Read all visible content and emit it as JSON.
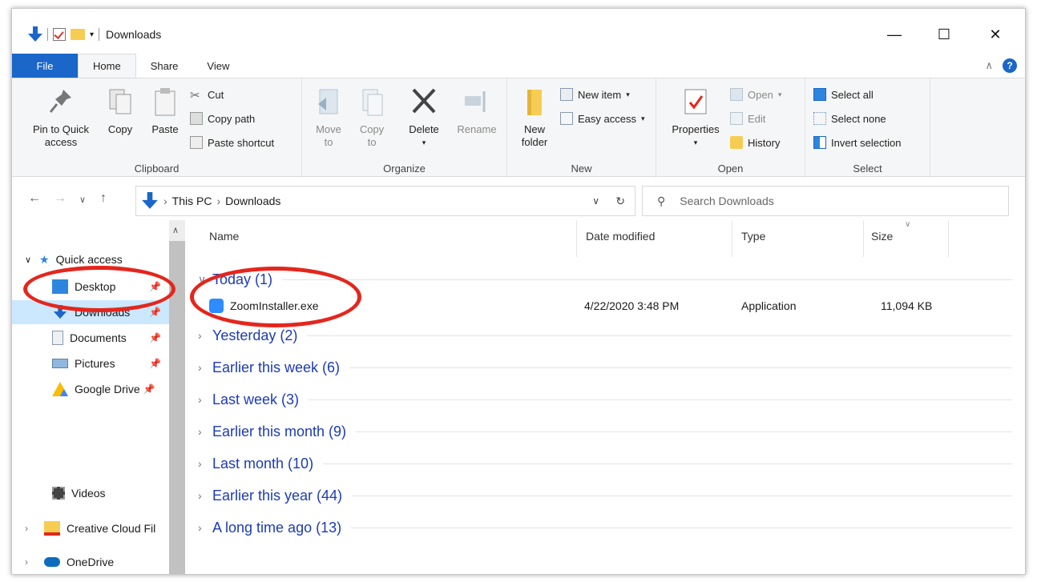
{
  "window": {
    "title": "Downloads"
  },
  "tabs": [
    {
      "label": "File"
    },
    {
      "label": "Home"
    },
    {
      "label": "Share"
    },
    {
      "label": "View"
    }
  ],
  "ribbon": {
    "clipboard": {
      "label": "Clipboard",
      "pin_line1": "Pin to Quick",
      "pin_line2": "access",
      "copy": "Copy",
      "paste": "Paste",
      "cut": "Cut",
      "copy_path": "Copy path",
      "paste_shortcut": "Paste shortcut"
    },
    "organize": {
      "label": "Organize",
      "move_line1": "Move",
      "move_line2": "to",
      "copy_line1": "Copy",
      "copy_line2": "to",
      "delete": "Delete",
      "rename": "Rename"
    },
    "new": {
      "label": "New",
      "new_folder_line1": "New",
      "new_folder_line2": "folder",
      "new_item": "New item",
      "easy_access": "Easy access"
    },
    "open": {
      "label": "Open",
      "properties": "Properties",
      "open": "Open",
      "edit": "Edit",
      "history": "History"
    },
    "select": {
      "label": "Select",
      "select_all": "Select all",
      "select_none": "Select none",
      "invert": "Invert selection"
    }
  },
  "address": {
    "segments": [
      "This PC",
      "Downloads"
    ],
    "search_placeholder": "Search Downloads"
  },
  "nav": {
    "quick_access": "Quick access",
    "items": [
      {
        "label": "Desktop"
      },
      {
        "label": "Downloads"
      },
      {
        "label": "Documents"
      },
      {
        "label": "Pictures"
      },
      {
        "label": "Google Drive"
      },
      {
        "label": "Videos"
      },
      {
        "label": "Creative Cloud Fil"
      },
      {
        "label": "OneDrive"
      }
    ]
  },
  "columns": {
    "name": "Name",
    "date": "Date modified",
    "type": "Type",
    "size": "Size"
  },
  "groups": [
    {
      "label": "Today (1)"
    },
    {
      "label": "Yesterday (2)"
    },
    {
      "label": "Earlier this week (6)"
    },
    {
      "label": "Last week (3)"
    },
    {
      "label": "Earlier this month (9)"
    },
    {
      "label": "Last month (10)"
    },
    {
      "label": "Earlier this year (44)"
    },
    {
      "label": "A long time ago (13)"
    }
  ],
  "file": {
    "name": "ZoomInstaller.exe",
    "date": "4/22/2020 3:48 PM",
    "type": "Application",
    "size": "11,094 KB"
  },
  "colors": {
    "accent": "#1a66c9",
    "highlight": "#e4261d",
    "group_text": "#1d3bb5",
    "selection": "#cce8ff"
  }
}
